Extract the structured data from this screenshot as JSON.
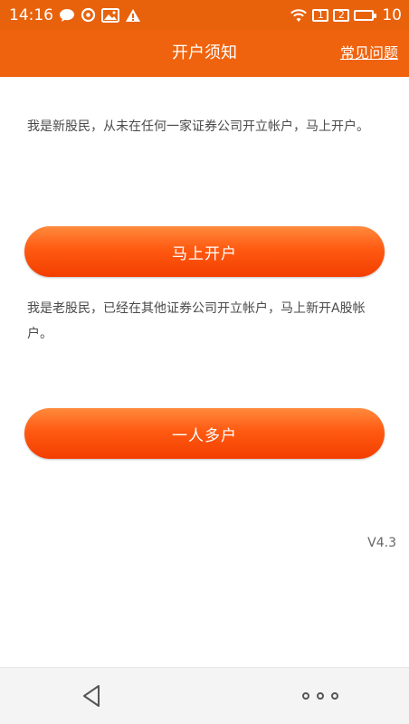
{
  "status_bar": {
    "time": "14:16",
    "icons_left": [
      "chat-bubble-icon",
      "sync-icon",
      "image-icon",
      "warning-icon"
    ],
    "icons_right": [
      "wifi-icon",
      "sim1-icon",
      "sim2-icon",
      "battery-icon"
    ],
    "sim1": "1",
    "sim2": "2",
    "battery": "10"
  },
  "header": {
    "title": "开户须知",
    "faq_label": "常见问题",
    "background": "#f0630e"
  },
  "main": {
    "new_investor_text": "我是新股民，从未在任何一家证券公司开立帐户，马上开户。",
    "open_account_label": "马上开户",
    "existing_investor_text": "我是老股民，已经在其他证券公司开立帐户，马上新开A股帐户。",
    "multi_account_label": "一人多户",
    "button_color": "#ff5a12"
  },
  "footer": {
    "version": "V4.3"
  },
  "nav_bar": {
    "icons": [
      "back-triangle-icon",
      "more-dots-icon"
    ]
  }
}
